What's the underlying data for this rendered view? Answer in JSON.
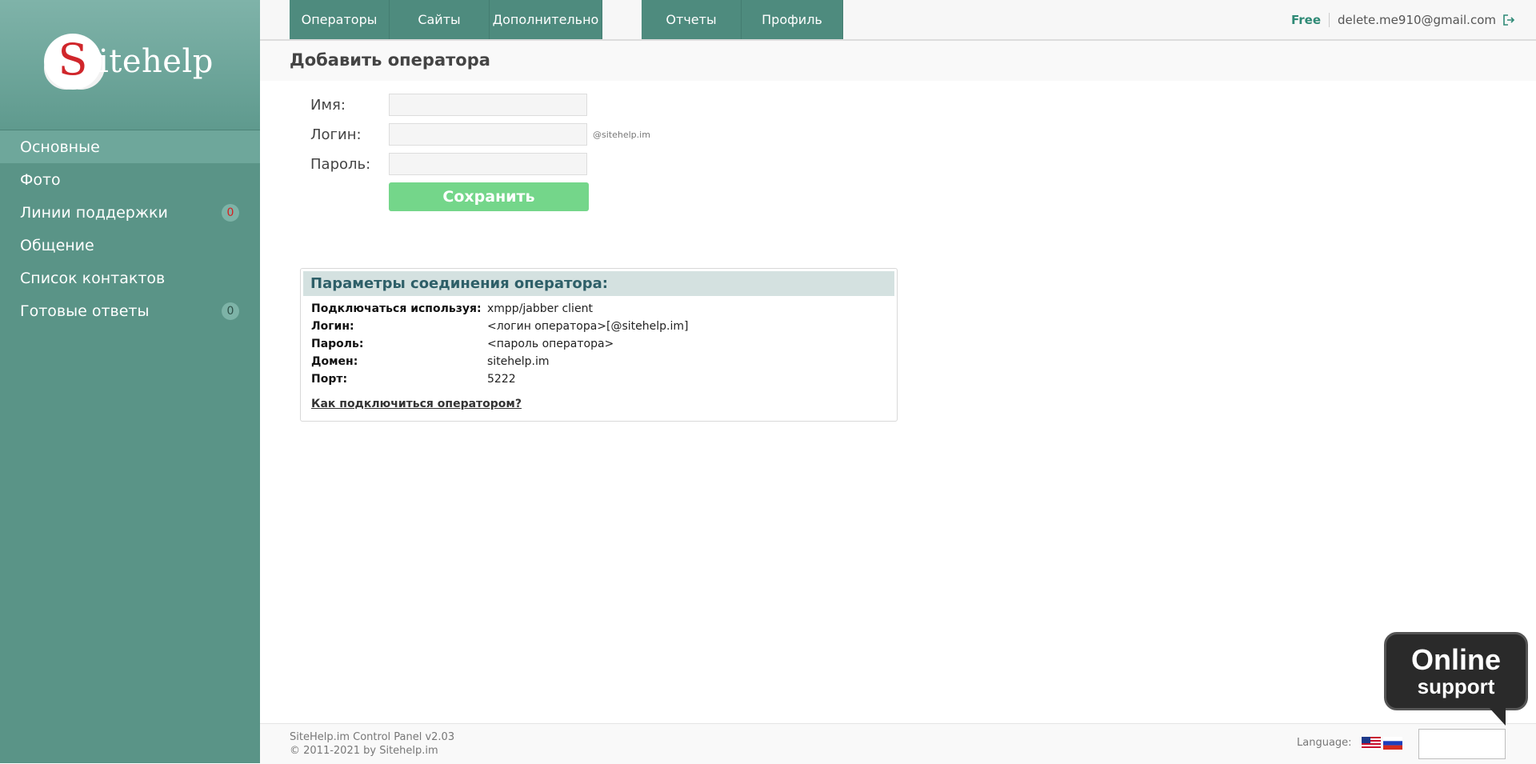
{
  "sidebar": {
    "logo": {
      "letter": "S",
      "text": "itehelp"
    },
    "items": [
      {
        "label": "Основные",
        "active": true
      },
      {
        "label": "Фото"
      },
      {
        "label": "Линии поддержки",
        "badge": "0",
        "badge_color": "#d81e1e"
      },
      {
        "label": "Общение"
      },
      {
        "label": "Список контактов"
      },
      {
        "label": "Готовые ответы",
        "badge": "0"
      }
    ]
  },
  "topnav": {
    "tabs": [
      "Операторы",
      "Сайты",
      "Дополнительно",
      "Отчеты",
      "Профиль"
    ],
    "plan": "Free",
    "email": "delete.me910@gmail.com",
    "logout_icon": "logout-icon"
  },
  "page": {
    "title": "Добавить оператора"
  },
  "form": {
    "name_label": "Имя:",
    "login_label": "Логин:",
    "login_suffix": "@sitehelp.im",
    "password_label": "Пароль:",
    "save_label": "Сохранить"
  },
  "params": {
    "title": "Параметры соединения оператора:",
    "rows": [
      {
        "key": "Подключаться используя:",
        "value": "xmpp/jabber client"
      },
      {
        "key": "Логин:",
        "value": "<логин оператора>[@sitehelp.im]"
      },
      {
        "key": "Пароль:",
        "value": "<пароль оператора>"
      },
      {
        "key": "Домен:",
        "value": "sitehelp.im"
      },
      {
        "key": "Порт:",
        "value": "5222"
      }
    ],
    "help_link": "Как подключиться оператором?"
  },
  "footer": {
    "copyright_line1": "SiteHelp.im Control Panel v2.03",
    "copyright_line2": "© 2011-2021 by Sitehelp.im",
    "language_label": "Language:",
    "flags": [
      "flag-us-icon",
      "flag-ru-icon"
    ]
  },
  "support_widget": {
    "line1": "Online",
    "line2": "support"
  },
  "colors": {
    "sidebar": "#5a9487",
    "tabs": "#4e8b7e",
    "save_button": "#74d68a",
    "accent": "#2f8a76"
  }
}
